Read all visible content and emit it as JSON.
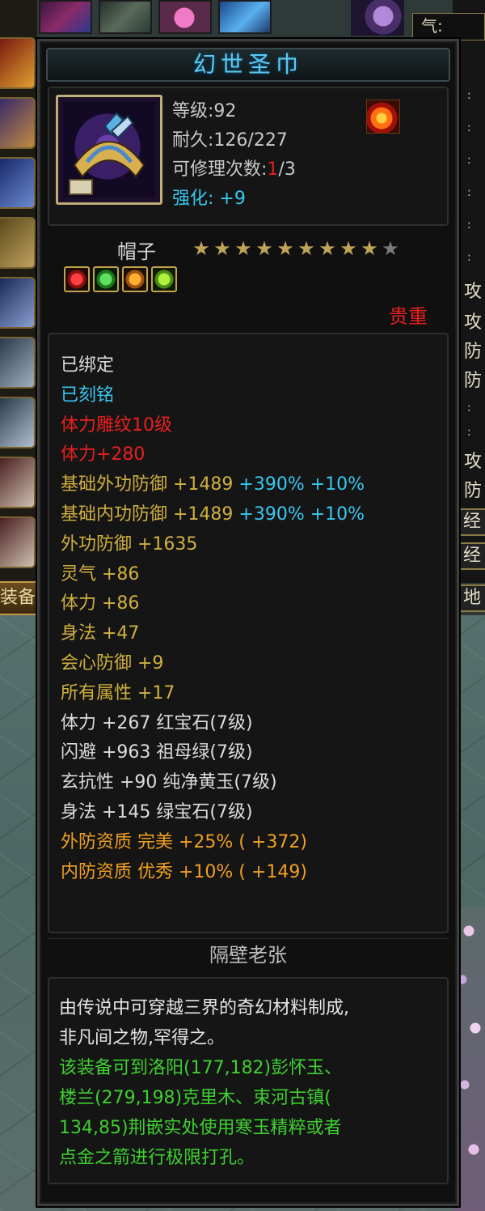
{
  "item": {
    "name": "幻世圣巾",
    "level": "等级:92",
    "durability": "耐久:126/227",
    "repair_prefix": "可修理次数:",
    "repair_current": "1",
    "repair_suffix": "/3",
    "enhance": "强化: +9",
    "type": "帽子",
    "stars": {
      "filled": 9,
      "total": 10
    },
    "rarity": "贵重"
  },
  "attributes": [
    {
      "parts": [
        {
          "text": "已绑定",
          "color": "white"
        }
      ]
    },
    {
      "parts": [
        {
          "text": "已刻铭",
          "color": "blue"
        }
      ]
    },
    {
      "parts": [
        {
          "text": "体力雕纹10级",
          "color": "red"
        }
      ]
    },
    {
      "parts": [
        {
          "text": "体力+280",
          "color": "red"
        }
      ]
    },
    {
      "parts": [
        {
          "text": "基础外功防御 +1489 ",
          "color": "yellow"
        },
        {
          "text": "+390% +10%",
          "color": "blue"
        }
      ]
    },
    {
      "parts": [
        {
          "text": "基础内功防御 +1489 ",
          "color": "yellow"
        },
        {
          "text": "+390% +10%",
          "color": "blue"
        }
      ]
    },
    {
      "parts": [
        {
          "text": "外功防御 +1635",
          "color": "yellow"
        }
      ]
    },
    {
      "parts": [
        {
          "text": "灵气 +86",
          "color": "yellow"
        }
      ]
    },
    {
      "parts": [
        {
          "text": "体力 +86",
          "color": "yellow"
        }
      ]
    },
    {
      "parts": [
        {
          "text": "身法 +47",
          "color": "yellow"
        }
      ]
    },
    {
      "parts": [
        {
          "text": "会心防御 +9",
          "color": "yellow"
        }
      ]
    },
    {
      "parts": [
        {
          "text": "所有属性 +17",
          "color": "yellow"
        }
      ]
    },
    {
      "parts": [
        {
          "text": "体力 +267 红宝石(7级)",
          "color": "white"
        }
      ]
    },
    {
      "parts": [
        {
          "text": "闪避 +963 祖母绿(7级)",
          "color": "white"
        }
      ]
    },
    {
      "parts": [
        {
          "text": "玄抗性 +90 纯净黄玉(7级)",
          "color": "white"
        }
      ]
    },
    {
      "parts": [
        {
          "text": "身法 +145 绿宝石(7级)",
          "color": "white"
        }
      ]
    },
    {
      "parts": [
        {
          "text": "外防资质  完美 +25% ( +372)",
          "color": "orange"
        }
      ]
    },
    {
      "parts": [
        {
          "text": "内防资质  优秀 +10% ( +149)",
          "color": "orange"
        }
      ]
    }
  ],
  "maker": "隔壁老张",
  "description": [
    {
      "text": "由传说中可穿越三界的奇幻材料制成,",
      "color": "white"
    },
    {
      "text": "非凡间之物,罕得之。",
      "color": "white"
    },
    {
      "text": "该装备可到洛阳(177,182)彭怀玉、",
      "color": "green"
    },
    {
      "text": "楼兰(279,198)克里木、束河古镇(",
      "color": "green"
    },
    {
      "text": "134,85)荆嵌实处使用寒玉精粹或者",
      "color": "green"
    },
    {
      "text": "点金之箭进行极限打孔。",
      "color": "green"
    }
  ],
  "ui": {
    "equip_tab": "装备",
    "right_qi": "气:",
    "right_labels": [
      "攻",
      "攻",
      "防",
      "防",
      "攻",
      "防"
    ],
    "right_buttons": [
      "经",
      "经",
      "地"
    ]
  },
  "colors": {
    "white": "#dcdcdc",
    "blue": "#38c8f0",
    "red": "#e82020",
    "yellow": "#d0b040",
    "orange": "#f0a020",
    "green": "#3ed030"
  },
  "icons": {
    "item": "cap-icon",
    "skill": "flame-icon",
    "gems": [
      "red-gem-icon",
      "green-gem-icon",
      "orange-gem-icon",
      "lime-gem-icon"
    ]
  }
}
